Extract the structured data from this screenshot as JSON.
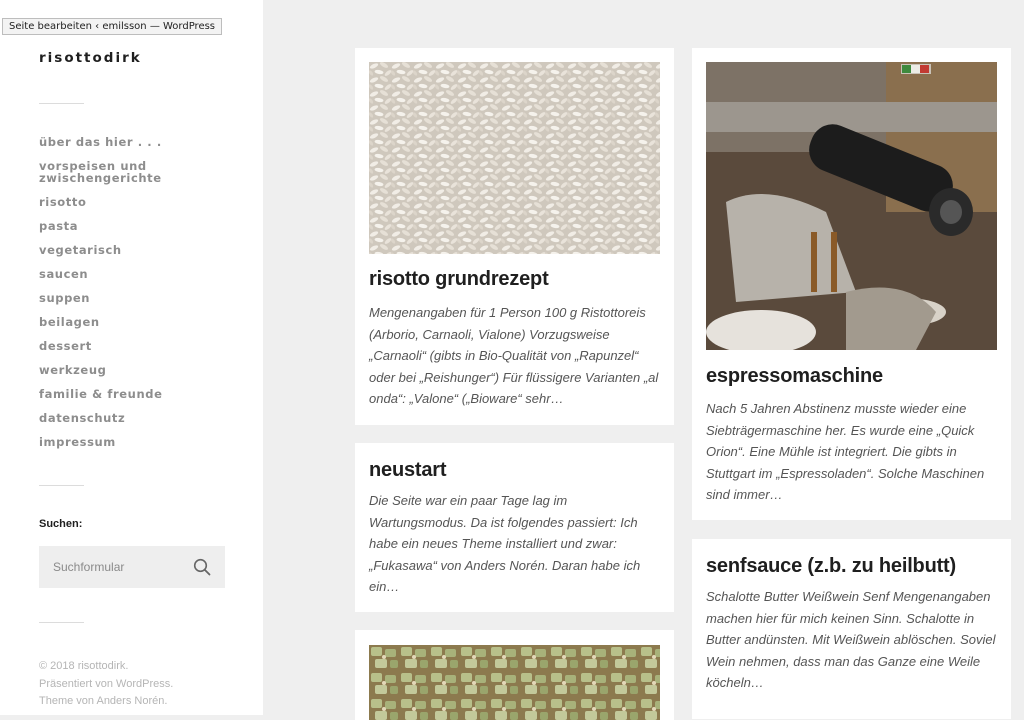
{
  "tooltip": "Seite bearbeiten ‹ emilsson — WordPress",
  "site_title": "risottodirk",
  "nav": [
    "über das hier . . .",
    "vorspeisen und zwischengerichte",
    "risotto",
    "pasta",
    "vegetarisch",
    "saucen",
    "suppen",
    "beilagen",
    "dessert",
    "werkzeug",
    "familie & freunde",
    "datenschutz",
    "impressum"
  ],
  "search": {
    "label": "Suchen:",
    "placeholder": "Suchformular"
  },
  "footer": {
    "copyright": "© 2018 risottodirk.",
    "powered": "Präsentiert von WordPress.",
    "theme": "Theme von Anders Norén."
  },
  "posts": [
    {
      "title": "risotto grundrezept",
      "excerpt": "Mengenangaben für 1 Person 100 g Ristottoreis (Arborio, Carnaoli, Vialone) Vorzugsweise „Carnaoli“ (gibts in Bio-Qualität von „Rapunzel“ oder bei „Reishunger“) Für flüssigere Varianten „al onda“: „Valone“ („Bioware“ sehr…"
    },
    {
      "title": "espressomaschine",
      "excerpt": "Nach 5 Jahren Abstinenz musste wieder eine Siebträgermaschine her. Es wurde eine „Quick Orion“. Eine Mühle ist integriert. Die gibts in Stuttgart im „Espressoladen“. Solche Maschinen sind immer…"
    },
    {
      "title": "neustart",
      "excerpt": "Die Seite war ein paar Tage lag im Wartungsmodus. Da ist folgendes passiert: Ich habe ein neues Theme installiert und zwar: „Fukasawa“ von Anders Norén. Daran habe ich ein…"
    },
    {
      "title": "senfsauce (z.b. zu heilbutt)",
      "excerpt": "Schalotte Butter Weißwein Senf Mengenangaben machen hier für mich keinen Sinn. Schalotte in Butter andünsten. Mit Weißwein ablöschen. Soviel Wein nehmen, dass man das Ganze eine Weile  köcheln…"
    }
  ],
  "colors": {
    "background": "#efefef",
    "sidebar": "#ffffff",
    "nav_text": "#8d8d8d",
    "title_text": "#1f1f1f",
    "excerpt_text": "#555555"
  }
}
